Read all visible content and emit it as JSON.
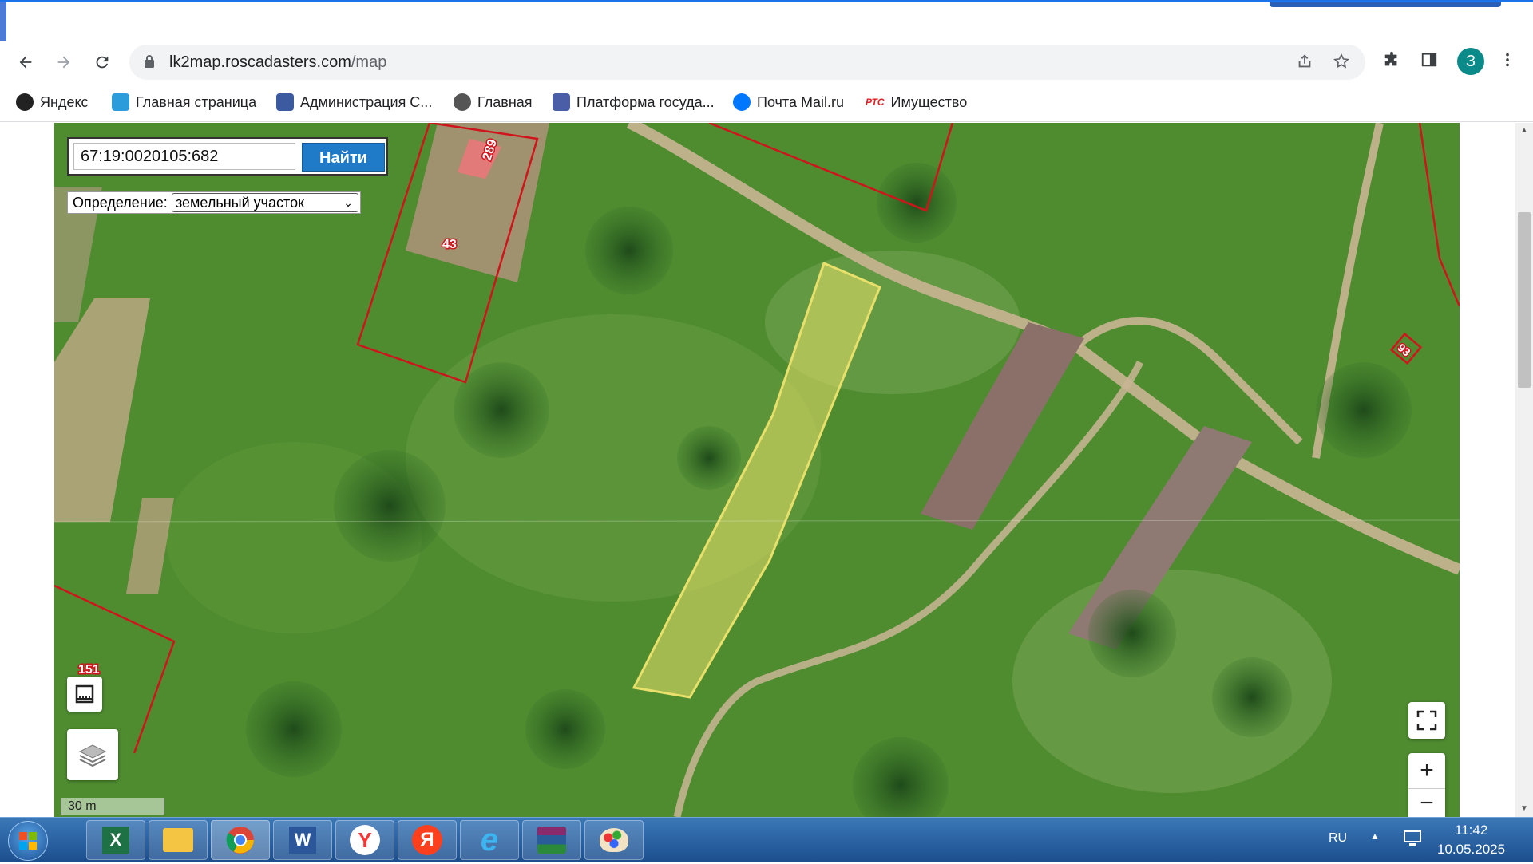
{
  "browser": {
    "url_host": "lk2map.roscadasters.com",
    "url_path": "/map",
    "profile_initial": "З"
  },
  "bookmarks": [
    {
      "label": "Яндекс",
      "icon": "yandex-icon",
      "color": "#222222"
    },
    {
      "label": "Главная страница",
      "icon": "gosuslugi-icon",
      "color": "#2d9cdb"
    },
    {
      "label": "Администрация С...",
      "icon": "coat-of-arms-icon",
      "color": "#3b5aa0"
    },
    {
      "label": "Главная",
      "icon": "globe-icon",
      "color": "#555555"
    },
    {
      "label": "Платформа госуда...",
      "icon": "eagle-icon",
      "color": "#4a5ea8"
    },
    {
      "label": "Почта Mail.ru",
      "icon": "mail-icon",
      "color": "#0077ff"
    },
    {
      "label": "Имущество",
      "icon": "rts-icon",
      "color": "#e31e24",
      "badge": "РТС"
    }
  ],
  "map": {
    "search_value": "67:19:0020105:682",
    "search_button": "Найти",
    "definition_label": "Определение:",
    "definition_value": "земельный участок",
    "parcel_labels": [
      "289",
      "43",
      "151",
      "93"
    ],
    "scale_label": "30 m",
    "zoom_in": "+",
    "zoom_out": "−",
    "highlight_color": "#e8e06a",
    "boundary_color": "#d0141c"
  },
  "taskbar": {
    "apps": [
      "excel-icon",
      "explorer-icon",
      "chrome-icon",
      "word-icon",
      "yandex-browser-icon",
      "yandex-icon",
      "internet-explorer-icon",
      "winrar-icon",
      "paint-icon"
    ],
    "app_letters": [
      "X",
      "",
      "",
      "W",
      "Y",
      "Я",
      "e",
      "",
      ""
    ],
    "language": "RU",
    "time": "11:42",
    "date": "10.05.2025"
  }
}
